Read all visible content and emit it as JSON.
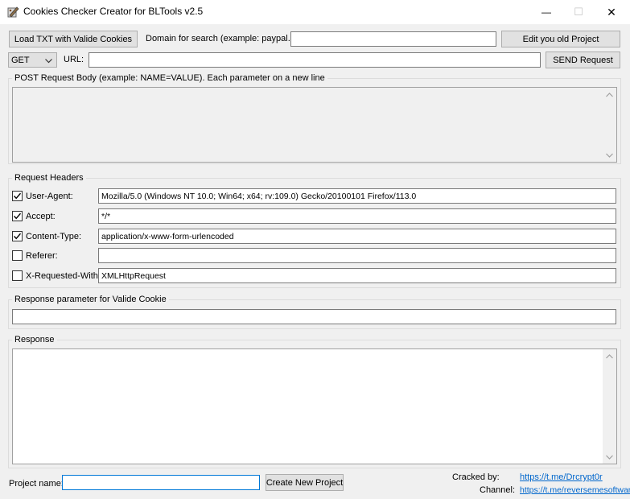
{
  "window": {
    "title": "Cookies Checker Creator for BLTools v2.5",
    "minimize_glyph": "—",
    "maximize_glyph": "☐",
    "close_glyph": "✕"
  },
  "toolbar": {
    "load_button": "Load TXT with Valide Cookies",
    "domain_label": "Domain for search (example: paypal.com):",
    "domain_value": "",
    "edit_button": "Edit you old Project"
  },
  "request": {
    "method": "GET",
    "url_label": "URL:",
    "url_value": "",
    "send_button": "SEND Request",
    "post_body_caption": "POST Request Body (example: NAME=VALUE). Each parameter on a new line",
    "post_body_value": ""
  },
  "headers": {
    "caption": "Request Headers",
    "rows": [
      {
        "label": "User-Agent:",
        "checked": true,
        "value": "Mozilla/5.0 (Windows NT 10.0; Win64; x64; rv:109.0) Gecko/20100101 Firefox/113.0"
      },
      {
        "label": "Accept:",
        "checked": true,
        "value": "*/*"
      },
      {
        "label": "Content-Type:",
        "checked": true,
        "value": "application/x-www-form-urlencoded"
      },
      {
        "label": "Referer:",
        "checked": false,
        "value": ""
      },
      {
        "label": "X-Requested-With:",
        "checked": false,
        "value": "XMLHttpRequest"
      }
    ]
  },
  "valid_cookie": {
    "caption": "Response parameter for Valide Cookie",
    "value": ""
  },
  "response": {
    "caption": "Response",
    "value": ""
  },
  "footer": {
    "project_label": "Project name:",
    "project_value": "",
    "create_button": "Create New Project",
    "cracked_label": "Cracked by:",
    "cracked_link": "https://t.me/Drcrypt0r",
    "channel_label": "Channel:",
    "channel_link": "https://t.me/reversemesoftware"
  },
  "colors": {
    "window_bg": "#f0f0f0",
    "link": "#0066cc",
    "focus_border": "#0078d7"
  }
}
